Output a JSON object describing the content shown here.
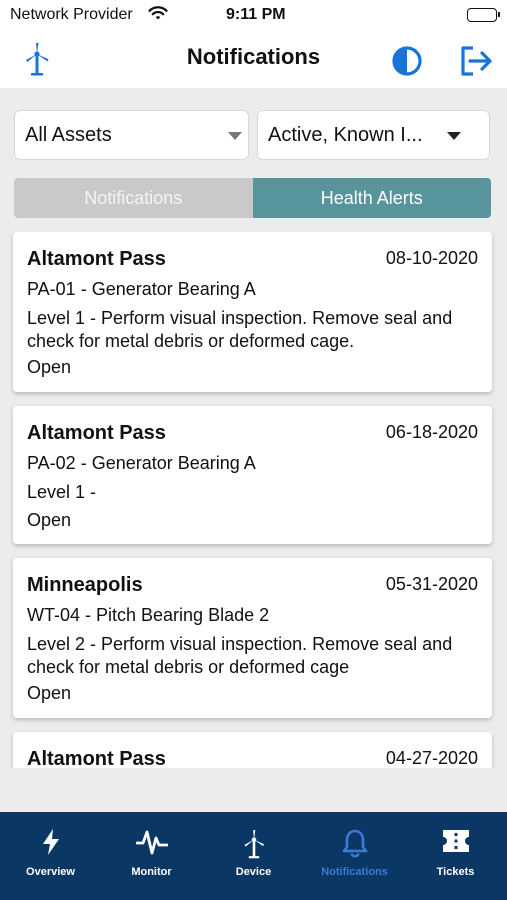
{
  "status_bar": {
    "carrier": "Network Provider",
    "time": "9:11 PM"
  },
  "header": {
    "title": "Notifications"
  },
  "filters": {
    "assets": "All Assets",
    "status": "Active, Known I..."
  },
  "segments": {
    "notifications": "Notifications",
    "health_alerts": "Health Alerts",
    "selected": "Health Alerts"
  },
  "cards": [
    {
      "site": "Altamont Pass",
      "date": "08-10-2020",
      "asset": "PA-01 - Generator Bearing A",
      "description": "Level 1 - Perform visual inspection. Remove seal and check for metal debris or deformed cage.",
      "status": "Open"
    },
    {
      "site": "Altamont Pass",
      "date": "06-18-2020",
      "asset": "PA-02 - Generator Bearing A",
      "description": "Level 1 -",
      "status": "Open"
    },
    {
      "site": "Minneapolis",
      "date": "05-31-2020",
      "asset": "WT-04 - Pitch Bearing Blade 2",
      "description": "Level 2 - Perform visual inspection. Remove seal and check for metal debris or deformed cage",
      "status": "Open"
    },
    {
      "site": "Altamont Pass",
      "date": "04-27-2020"
    }
  ],
  "tabs": [
    {
      "label": "Overview",
      "icon": "bolt-icon"
    },
    {
      "label": "Monitor",
      "icon": "pulse-icon"
    },
    {
      "label": "Device",
      "icon": "wind-turbine-icon"
    },
    {
      "label": "Notifications",
      "icon": "bell-icon",
      "active": true
    },
    {
      "label": "Tickets",
      "icon": "ticket-icon"
    }
  ],
  "colors": {
    "accent": "#1a73d9",
    "tab_bar": "#0b3765",
    "segment_active": "#57949c",
    "segment_inactive": "#c9c9c9",
    "active_tab_label": "#3a7bd5"
  }
}
